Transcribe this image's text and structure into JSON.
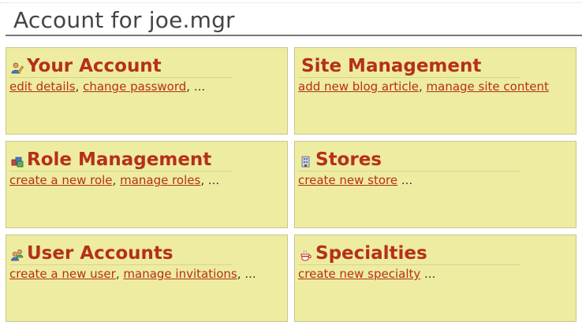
{
  "page": {
    "title": "Account for joe.mgr"
  },
  "cards": [
    {
      "title": "Your Account",
      "icon": "user-edit-icon",
      "links": [
        "edit details",
        "change  password"
      ],
      "more": "..."
    },
    {
      "title": "Site Management",
      "icon": "",
      "links": [
        "add new blog article",
        "manage site content"
      ],
      "more": ""
    },
    {
      "title": "Role Management",
      "icon": "roles-icon",
      "links": [
        "create a new role",
        "manage roles"
      ],
      "more": "..."
    },
    {
      "title": "Stores",
      "icon": "building-icon",
      "links": [
        "create new store"
      ],
      "more": "..."
    },
    {
      "title": "User Accounts",
      "icon": "users-icon",
      "links": [
        "create a new user",
        "manage invitations"
      ],
      "more": "..."
    },
    {
      "title": "Specialties",
      "icon": "coffee-cup-icon",
      "links": [
        "create new specialty"
      ],
      "more": "..."
    }
  ],
  "colors": {
    "card_bg": "#eeeca1",
    "accent": "#b5301a",
    "title_text": "#444444"
  }
}
